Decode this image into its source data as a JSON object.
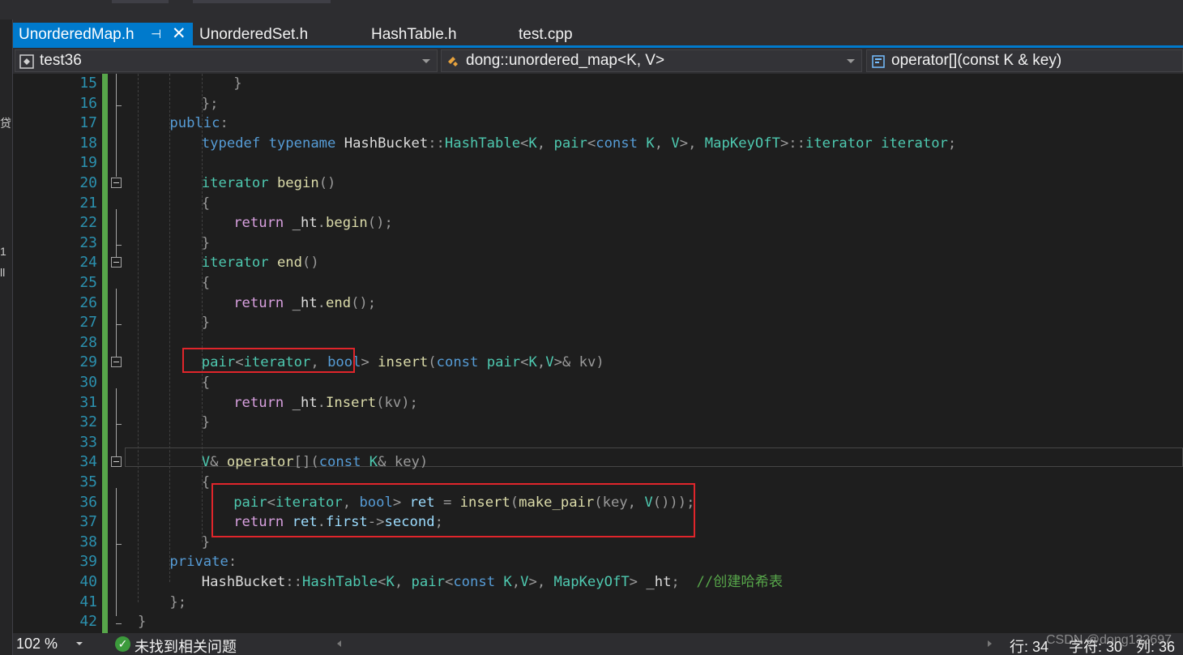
{
  "tabs": [
    {
      "label": "UnorderedMap.h",
      "active": true
    },
    {
      "label": "UnorderedSet.h",
      "active": false
    },
    {
      "label": "HashTable.h",
      "active": false
    },
    {
      "label": "test.cpp",
      "active": false
    }
  ],
  "tab_pin_glyph": "⊣",
  "tab_close_glyph": "✕",
  "navbar": {
    "project": "test36",
    "scope": "dong::unordered_map<K, V>",
    "member": "operator[](const K & key)"
  },
  "left_panel_fragments": [
    "贷",
    "1",
    "ll"
  ],
  "code_lines": [
    {
      "n": "15"
    },
    {
      "n": "16"
    },
    {
      "n": "17"
    },
    {
      "n": "18"
    },
    {
      "n": "19"
    },
    {
      "n": "20"
    },
    {
      "n": "21"
    },
    {
      "n": "22"
    },
    {
      "n": "23"
    },
    {
      "n": "24"
    },
    {
      "n": "25"
    },
    {
      "n": "26"
    },
    {
      "n": "27"
    },
    {
      "n": "28"
    },
    {
      "n": "29"
    },
    {
      "n": "30"
    },
    {
      "n": "31"
    },
    {
      "n": "32"
    },
    {
      "n": "33"
    },
    {
      "n": "34"
    },
    {
      "n": "35"
    },
    {
      "n": "36"
    },
    {
      "n": "37"
    },
    {
      "n": "38"
    },
    {
      "n": "39"
    },
    {
      "n": "40"
    },
    {
      "n": "41"
    },
    {
      "n": "42"
    }
  ],
  "code_tokens": [
    [
      [
        "pm",
        "}"
      ]
    ],
    [
      [
        "pm",
        "};"
      ]
    ],
    [
      [
        "kw",
        "public"
      ],
      [
        "pm",
        ":"
      ]
    ],
    [
      [
        "kw",
        "typedef typename "
      ],
      [
        "",
        "HashBucket"
      ],
      [
        "pm",
        "::"
      ],
      [
        "ty",
        "HashTable"
      ],
      [
        "pm",
        "<"
      ],
      [
        "ty",
        "K"
      ],
      [
        "pm",
        ", "
      ],
      [
        "ty",
        "pair"
      ],
      [
        "pm",
        "<"
      ],
      [
        "kw",
        "const "
      ],
      [
        "ty",
        "K"
      ],
      [
        "pm",
        ", "
      ],
      [
        "ty",
        "V"
      ],
      [
        "pm",
        ">, "
      ],
      [
        "ty",
        "MapKeyOfT"
      ],
      [
        "pm",
        ">::"
      ],
      [
        "ty",
        "iterator iterator"
      ],
      [
        "pm",
        ";"
      ]
    ],
    [],
    [
      [
        "ty",
        "iterator "
      ],
      [
        "fn",
        "begin"
      ],
      [
        "pm",
        "()"
      ]
    ],
    [
      [
        "pm",
        "{"
      ]
    ],
    [
      [
        "ct",
        "return "
      ],
      [
        "",
        "_ht"
      ],
      [
        "pm",
        "."
      ],
      [
        "fn",
        "begin"
      ],
      [
        "pm",
        "();"
      ]
    ],
    [
      [
        "pm",
        "}"
      ]
    ],
    [
      [
        "ty",
        "iterator "
      ],
      [
        "fn",
        "end"
      ],
      [
        "pm",
        "()"
      ]
    ],
    [
      [
        "pm",
        "{"
      ]
    ],
    [
      [
        "ct",
        "return "
      ],
      [
        "",
        "_ht"
      ],
      [
        "pm",
        "."
      ],
      [
        "fn",
        "end"
      ],
      [
        "pm",
        "();"
      ]
    ],
    [
      [
        "pm",
        "}"
      ]
    ],
    [],
    [
      [
        "ty",
        "pair"
      ],
      [
        "pm",
        "<"
      ],
      [
        "ty",
        "iterator"
      ],
      [
        "pm",
        ", "
      ],
      [
        "kw",
        "bool"
      ],
      [
        "pm",
        "> "
      ],
      [
        "fn",
        "insert"
      ],
      [
        "pm",
        "("
      ],
      [
        "kw",
        "const "
      ],
      [
        "ty",
        "pair"
      ],
      [
        "pm",
        "<"
      ],
      [
        "ty",
        "K"
      ],
      [
        "pm",
        ","
      ],
      [
        "ty",
        "V"
      ],
      [
        "pm",
        ">& "
      ],
      [
        "pm",
        "kv"
      ],
      [
        "pm",
        ")"
      ]
    ],
    [
      [
        "pm",
        "{"
      ]
    ],
    [
      [
        "ct",
        "return "
      ],
      [
        "",
        "_ht"
      ],
      [
        "pm",
        "."
      ],
      [
        "fn",
        "Insert"
      ],
      [
        "pm",
        "("
      ],
      [
        "pm",
        "kv"
      ],
      [
        "pm",
        ");"
      ]
    ],
    [
      [
        "pm",
        "}"
      ]
    ],
    [],
    [
      [
        "ty",
        "V"
      ],
      [
        "pm",
        "& "
      ],
      [
        "fn",
        "operator"
      ],
      [
        "pm",
        "[]("
      ],
      [
        "kw",
        "const "
      ],
      [
        "ty",
        "K"
      ],
      [
        "pm",
        "& "
      ],
      [
        "pm",
        "key"
      ],
      [
        "pm",
        ")"
      ]
    ],
    [
      [
        "pm",
        "{"
      ]
    ],
    [
      [
        "ty",
        "pair"
      ],
      [
        "pm",
        "<"
      ],
      [
        "ty",
        "iterator"
      ],
      [
        "pm",
        ", "
      ],
      [
        "kw",
        "bool"
      ],
      [
        "pm",
        "> "
      ],
      [
        "var",
        "ret"
      ],
      [
        "pm",
        " = "
      ],
      [
        "fn",
        "insert"
      ],
      [
        "pm",
        "("
      ],
      [
        "fn",
        "make_pair"
      ],
      [
        "pm",
        "("
      ],
      [
        "pm",
        "key"
      ],
      [
        "pm",
        ", "
      ],
      [
        "ty",
        "V"
      ],
      [
        "pm",
        "()));"
      ]
    ],
    [
      [
        "ct",
        "return "
      ],
      [
        "var",
        "ret"
      ],
      [
        "pm",
        "."
      ],
      [
        "var",
        "first"
      ],
      [
        "pm",
        "->"
      ],
      [
        "var",
        "second"
      ],
      [
        "pm",
        ";"
      ]
    ],
    [
      [
        "pm",
        "}"
      ]
    ],
    [
      [
        "kw",
        "private"
      ],
      [
        "pm",
        ":"
      ]
    ],
    [
      [
        "",
        "HashBucket"
      ],
      [
        "pm",
        "::"
      ],
      [
        "ty",
        "HashTable"
      ],
      [
        "pm",
        "<"
      ],
      [
        "ty",
        "K"
      ],
      [
        "pm",
        ", "
      ],
      [
        "ty",
        "pair"
      ],
      [
        "pm",
        "<"
      ],
      [
        "kw",
        "const "
      ],
      [
        "ty",
        "K"
      ],
      [
        "pm",
        ","
      ],
      [
        "ty",
        "V"
      ],
      [
        "pm",
        ">, "
      ],
      [
        "ty",
        "MapKeyOfT"
      ],
      [
        "pm",
        "> "
      ],
      [
        "",
        "_ht"
      ],
      [
        "pm",
        ";  "
      ],
      [
        "cm",
        "//创建哈希表"
      ]
    ],
    [
      [
        "pm",
        "};"
      ]
    ],
    [
      [
        "pm",
        "}"
      ]
    ]
  ],
  "status": {
    "zoom": "102 %",
    "issues": "未找到相关问题",
    "line": "行: 34",
    "char": "字符: 30",
    "col": "列: 36",
    "watermark": "CSDN @dong132697"
  },
  "colors": {
    "accent": "#007acc",
    "keyword": "#569cd6",
    "type": "#4ec9b0",
    "function": "#dcdcaa",
    "control": "#d8a0df",
    "comment": "#57a64a",
    "line_number": "#2b91af",
    "highlight_box": "#e0252b"
  },
  "icons": [
    "pin-icon",
    "close-icon",
    "project-icon",
    "class-icon",
    "method-icon",
    "fold-collapse-icon",
    "check-circle-icon",
    "dropdown-arrow-icon"
  ]
}
